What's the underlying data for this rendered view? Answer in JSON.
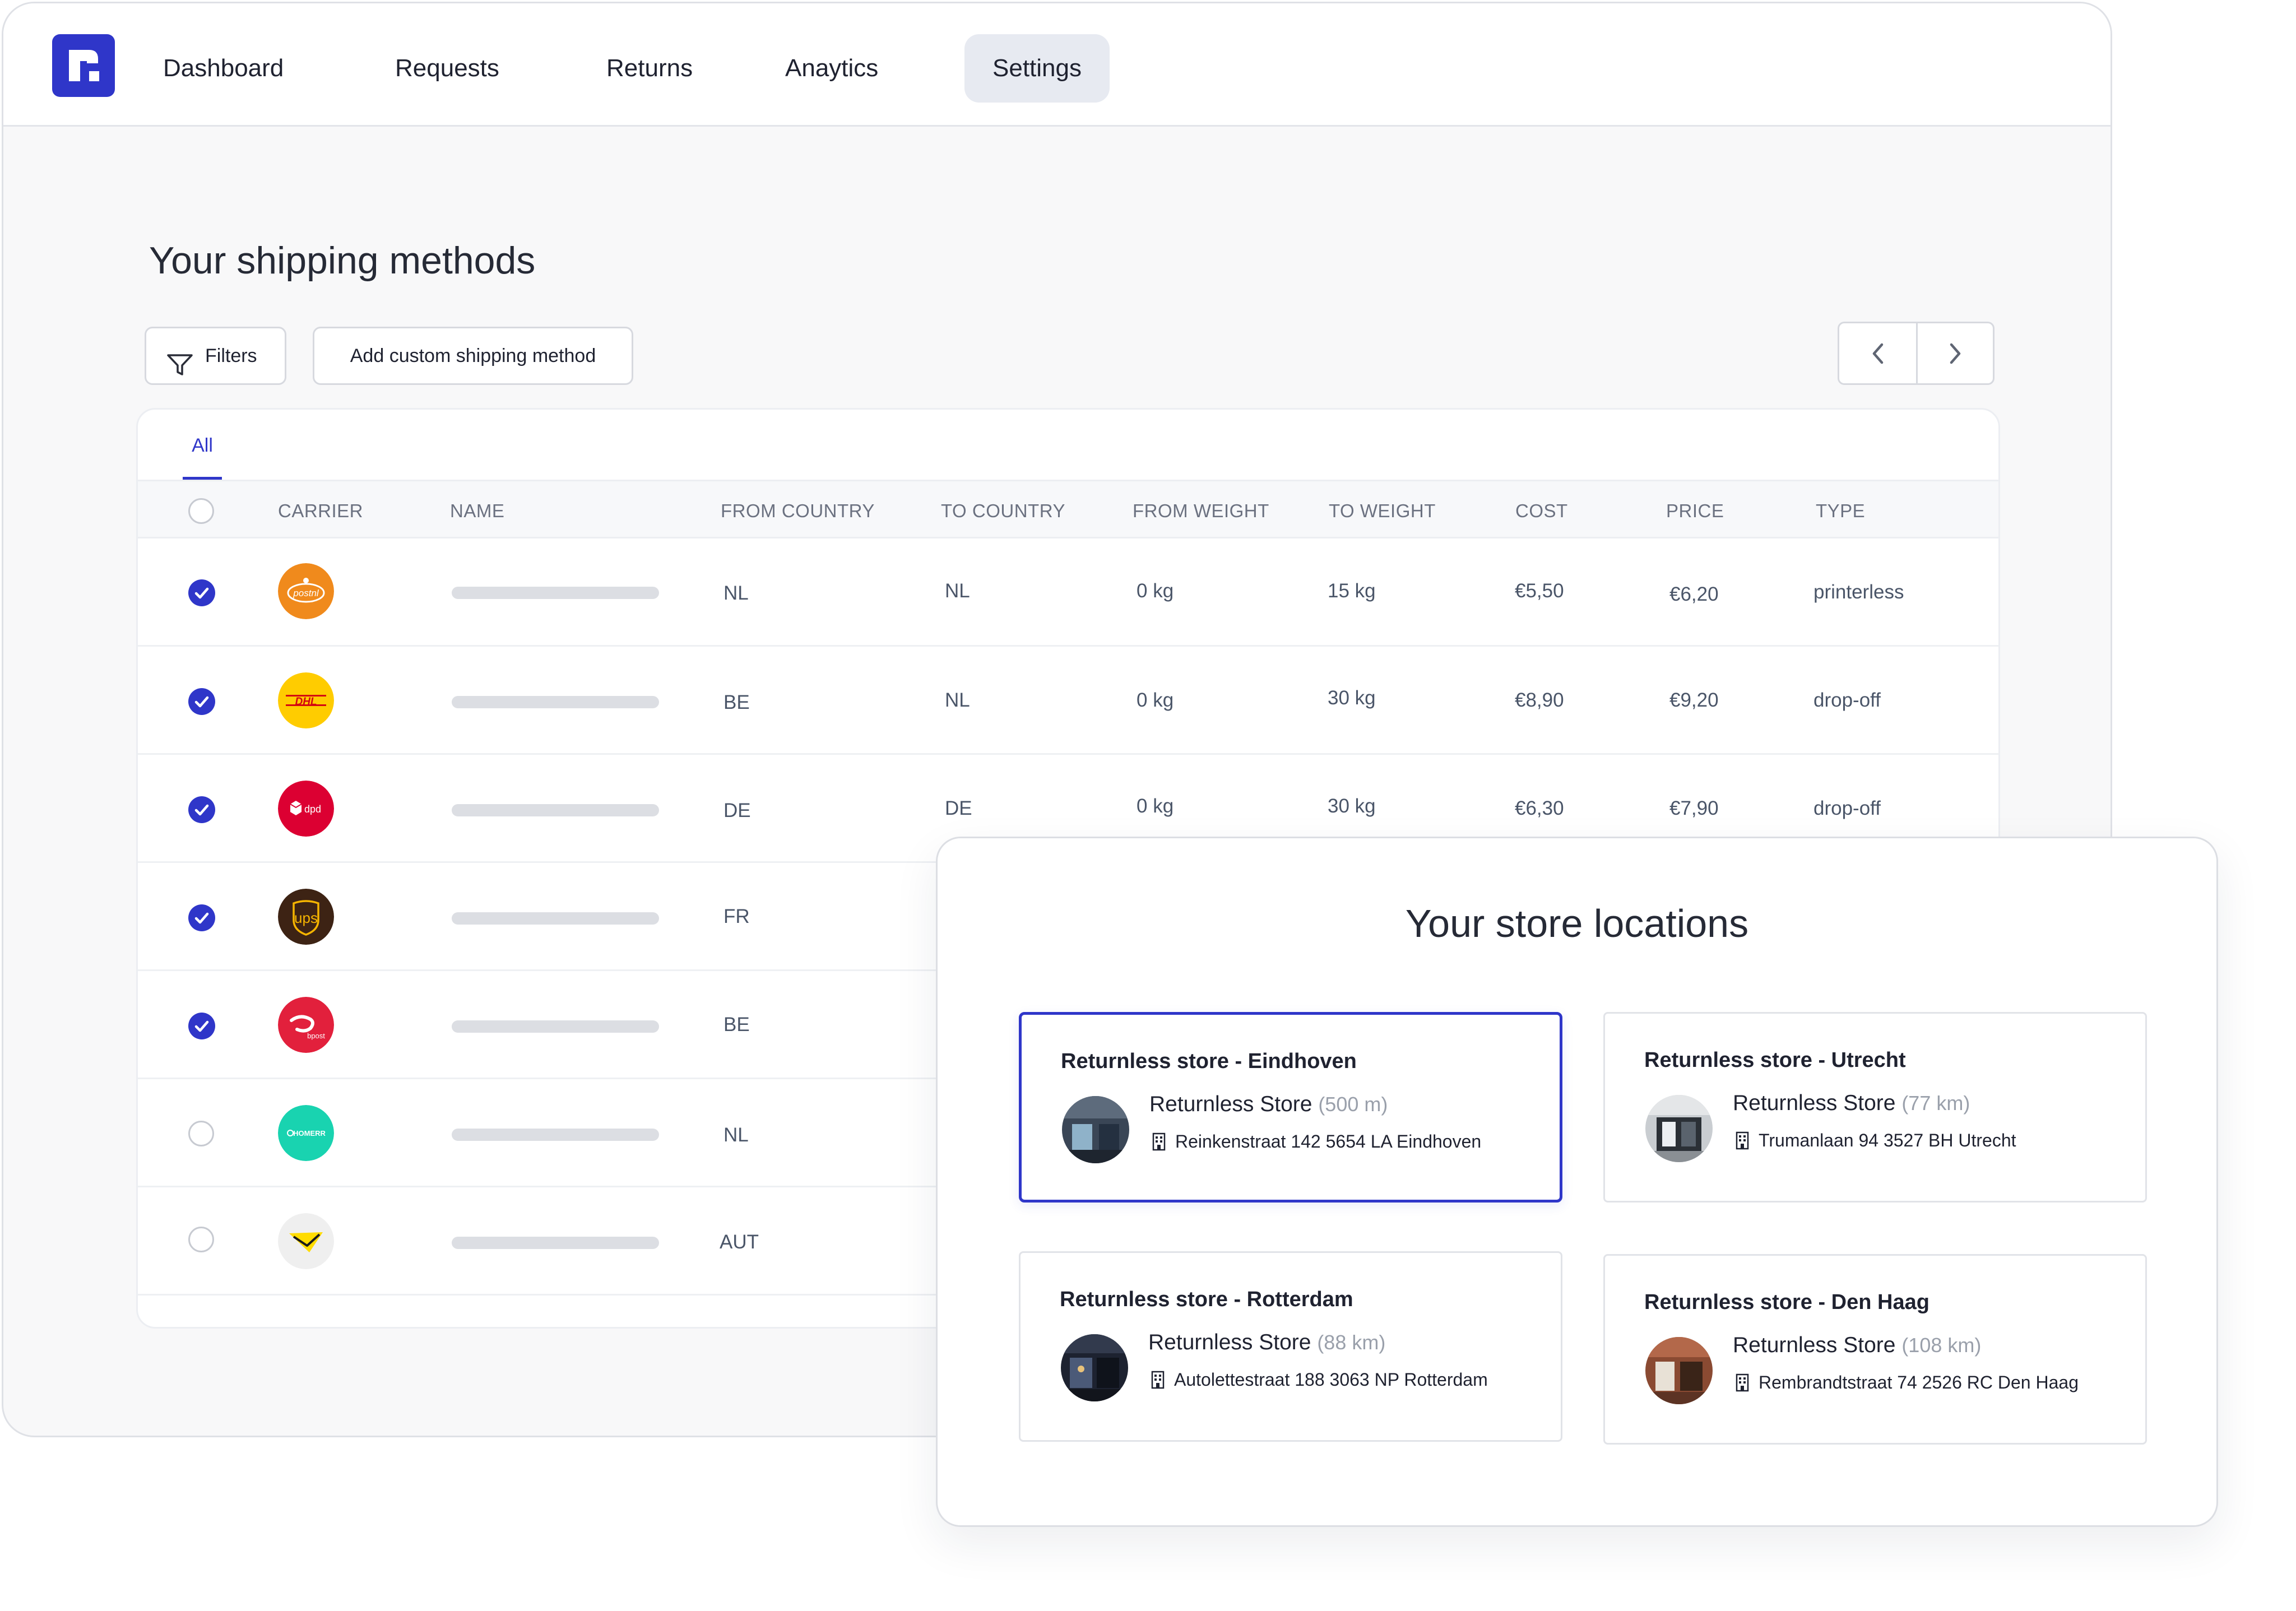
{
  "nav": {
    "items": [
      "Dashboard",
      "Requests",
      "Returns",
      "Anaytics",
      "Settings"
    ],
    "active": "Settings"
  },
  "page": {
    "title": "Your shipping methods",
    "filters_label": "Filters",
    "add_label": "Add custom shipping method"
  },
  "table": {
    "tab_all": "All",
    "columns": [
      "CARRIER",
      "NAME",
      "FROM COUNTRY",
      "TO COUNTRY",
      "FROM WEIGHT",
      "TO WEIGHT",
      "COST",
      "PRICE",
      "TYPE"
    ],
    "rows": [
      {
        "carrier_icon": "postnl-icon",
        "checked": true,
        "from_country": "NL",
        "to_country": "NL",
        "from_weight": "0 kg",
        "to_weight": "15 kg",
        "cost": "€5,50",
        "price": "€6,20",
        "type": "printerless"
      },
      {
        "carrier_icon": "dhl-icon",
        "checked": true,
        "from_country": "BE",
        "to_country": "NL",
        "from_weight": "0 kg",
        "to_weight": "30 kg",
        "cost": "€8,90",
        "price": "€9,20",
        "type": "drop-off"
      },
      {
        "carrier_icon": "dpd-icon",
        "checked": true,
        "from_country": "DE",
        "to_country": "DE",
        "from_weight": "0 kg",
        "to_weight": "30 kg",
        "cost": "€6,30",
        "price": "€7,90",
        "type": "drop-off"
      },
      {
        "carrier_icon": "ups-icon",
        "checked": true,
        "from_country": "FR"
      },
      {
        "carrier_icon": "bpost-icon",
        "checked": true,
        "from_country": "BE"
      },
      {
        "carrier_icon": "homerr-icon",
        "checked": false,
        "from_country": "NL"
      },
      {
        "carrier_icon": "austrian-post-icon",
        "checked": false,
        "from_country": "AUT"
      }
    ]
  },
  "carrier_labels": {
    "postnl": "postnl",
    "dhl": "DHL",
    "dpd": "dpd",
    "ups": "ups",
    "bpost": "bpost",
    "homerr": "HOMERR"
  },
  "stores": {
    "title": "Your store locations",
    "items": [
      {
        "name": "Returnless store - Eindhoven",
        "label": "Returnless Store",
        "distance": "(500 m)",
        "address": "Reinkenstraat 142 5654 LA Eindhoven",
        "selected": true
      },
      {
        "name": "Returnless store - Utrecht",
        "label": "Returnless Store",
        "distance": "(77 km)",
        "address": "Trumanlaan 94 3527 BH Utrecht",
        "selected": false
      },
      {
        "name": "Returnless store - Rotterdam",
        "label": "Returnless Store",
        "distance": "(88 km)",
        "address": "Autolettestraat 188 3063 NP Rotterdam",
        "selected": false
      },
      {
        "name": "Returnless store - Den Haag",
        "label": "Returnless Store",
        "distance": "(108 km)",
        "address": "Rembrandtstraat 74 2526 RC Den Haag",
        "selected": false
      }
    ]
  },
  "colors": {
    "accent": "#2f36c9",
    "postnl": "#f08a1c",
    "dhl": "#ffcc00",
    "dpd": "#dc0032",
    "ups": "#3d2314",
    "bpost": "#e2203c",
    "homerr": "#19d3b0"
  }
}
